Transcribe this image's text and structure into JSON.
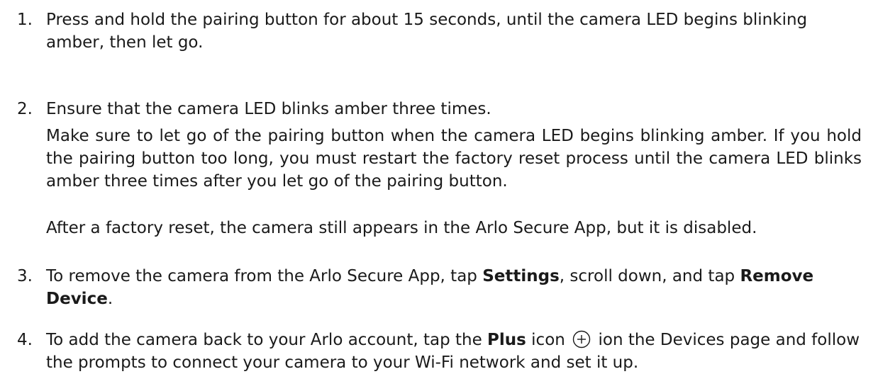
{
  "steps": [
    {
      "number": "1.",
      "text": "Press and hold the pairing button for about 15 seconds, until the camera LED begins blinking amber, then let go."
    },
    {
      "number": "2.",
      "text": "Ensure that the camera LED blinks amber three times.",
      "notes": [
        "Make sure to let go of the pairing button when the camera LED begins blinking amber. If you hold the pairing button too long, you must restart the factory reset process until the camera LED blinks amber three times after you let go of the pairing button.",
        "After a factory reset, the camera still appears in the Arlo Secure App, but it is disabled."
      ]
    },
    {
      "number": "3.",
      "text_before": "To remove the camera from the Arlo Secure App, tap ",
      "settings_label": "Settings",
      "text_middle": ", scroll down, and tap ",
      "remove_label": "Remove Device",
      "text_after": "."
    },
    {
      "number": "4.",
      "text_before": "To add the camera back to your Arlo account, tap the ",
      "plus_label": "Plus",
      "text_middle": " icon ",
      "text_after": " ion the Devices page and follow the prompts to connect your camera to your Wi-Fi network and set it up.",
      "icon": "plus-circle-icon"
    }
  ]
}
